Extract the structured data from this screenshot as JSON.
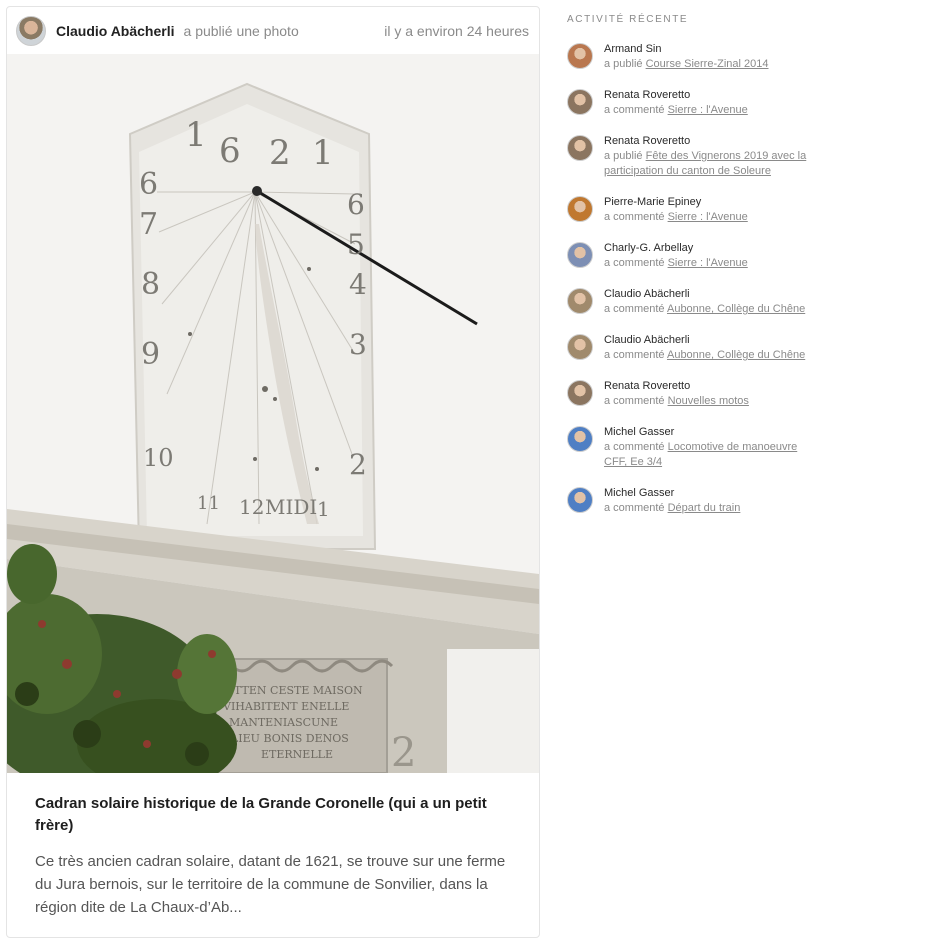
{
  "post": {
    "author": "Claudio Abächerli",
    "action": "a publié une photo",
    "time": "il y a environ 24 heures",
    "title": "Cadran solaire historique de la Grande Coronelle (qui a un petit frère)",
    "excerpt": "Ce très ancien cadran solaire, datant de 1621, se trouve sur une ferme du Jura bernois, sur le territoire de la commune de Sonvilier, dans la région dite de La Chaux-d’Ab..."
  },
  "sundial": {
    "year_digits": [
      "1",
      "6",
      "2",
      "1"
    ],
    "left_numerals": [
      "6",
      "7",
      "8",
      "9",
      "10"
    ],
    "right_numerals": [
      "6",
      "5",
      "4",
      "3",
      "2"
    ],
    "bottom_numerals": [
      "11",
      "12",
      "MIDI",
      "1"
    ],
    "plaque_lines": [
      "OTTEN CESTE MAISON",
      "VIHABITENT ENELLE",
      "MANTENIASCUNE",
      "LIEU BONIS DENOS",
      "ETERNELLE"
    ]
  },
  "sidebar": {
    "heading": "ACTIVITÉ RÉCENTE",
    "items": [
      {
        "user": "Armand Sin",
        "verb": "a publié",
        "link": "Course Sierre-Zinal 2014",
        "avatar_color": "#b9774f"
      },
      {
        "user": "Renata Roveretto",
        "verb": "a commenté",
        "link": "Sierre : l'Avenue",
        "avatar_color": "#8b7560"
      },
      {
        "user": "Renata Roveretto",
        "verb": "a publié",
        "link": "Fête des Vignerons 2019 avec la participation du canton de Soleure",
        "avatar_color": "#8b7560"
      },
      {
        "user": "Pierre-Marie Epiney",
        "verb": "a commenté",
        "link": "Sierre : l'Avenue",
        "avatar_color": "#c0782f"
      },
      {
        "user": "Charly-G. Arbellay",
        "verb": "a commenté",
        "link": "Sierre : l'Avenue",
        "avatar_color": "#7d8fb4"
      },
      {
        "user": "Claudio Abächerli",
        "verb": "a commenté",
        "link": "Aubonne, Collège du Chêne",
        "avatar_color": "#a08a6c"
      },
      {
        "user": "Claudio Abächerli",
        "verb": "a commenté",
        "link": "Aubonne, Collège du Chêne",
        "avatar_color": "#a08a6c"
      },
      {
        "user": "Renata Roveretto",
        "verb": "a commenté",
        "link": "Nouvelles motos",
        "avatar_color": "#8b7560"
      },
      {
        "user": "Michel Gasser",
        "verb": "a commenté",
        "link": "Locomotive de manoeuvre CFF,    Ee 3/4",
        "avatar_color": "#4f7fc4"
      },
      {
        "user": "Michel Gasser",
        "verb": "a commenté",
        "link": "Départ du train",
        "avatar_color": "#4f7fc4"
      }
    ]
  }
}
